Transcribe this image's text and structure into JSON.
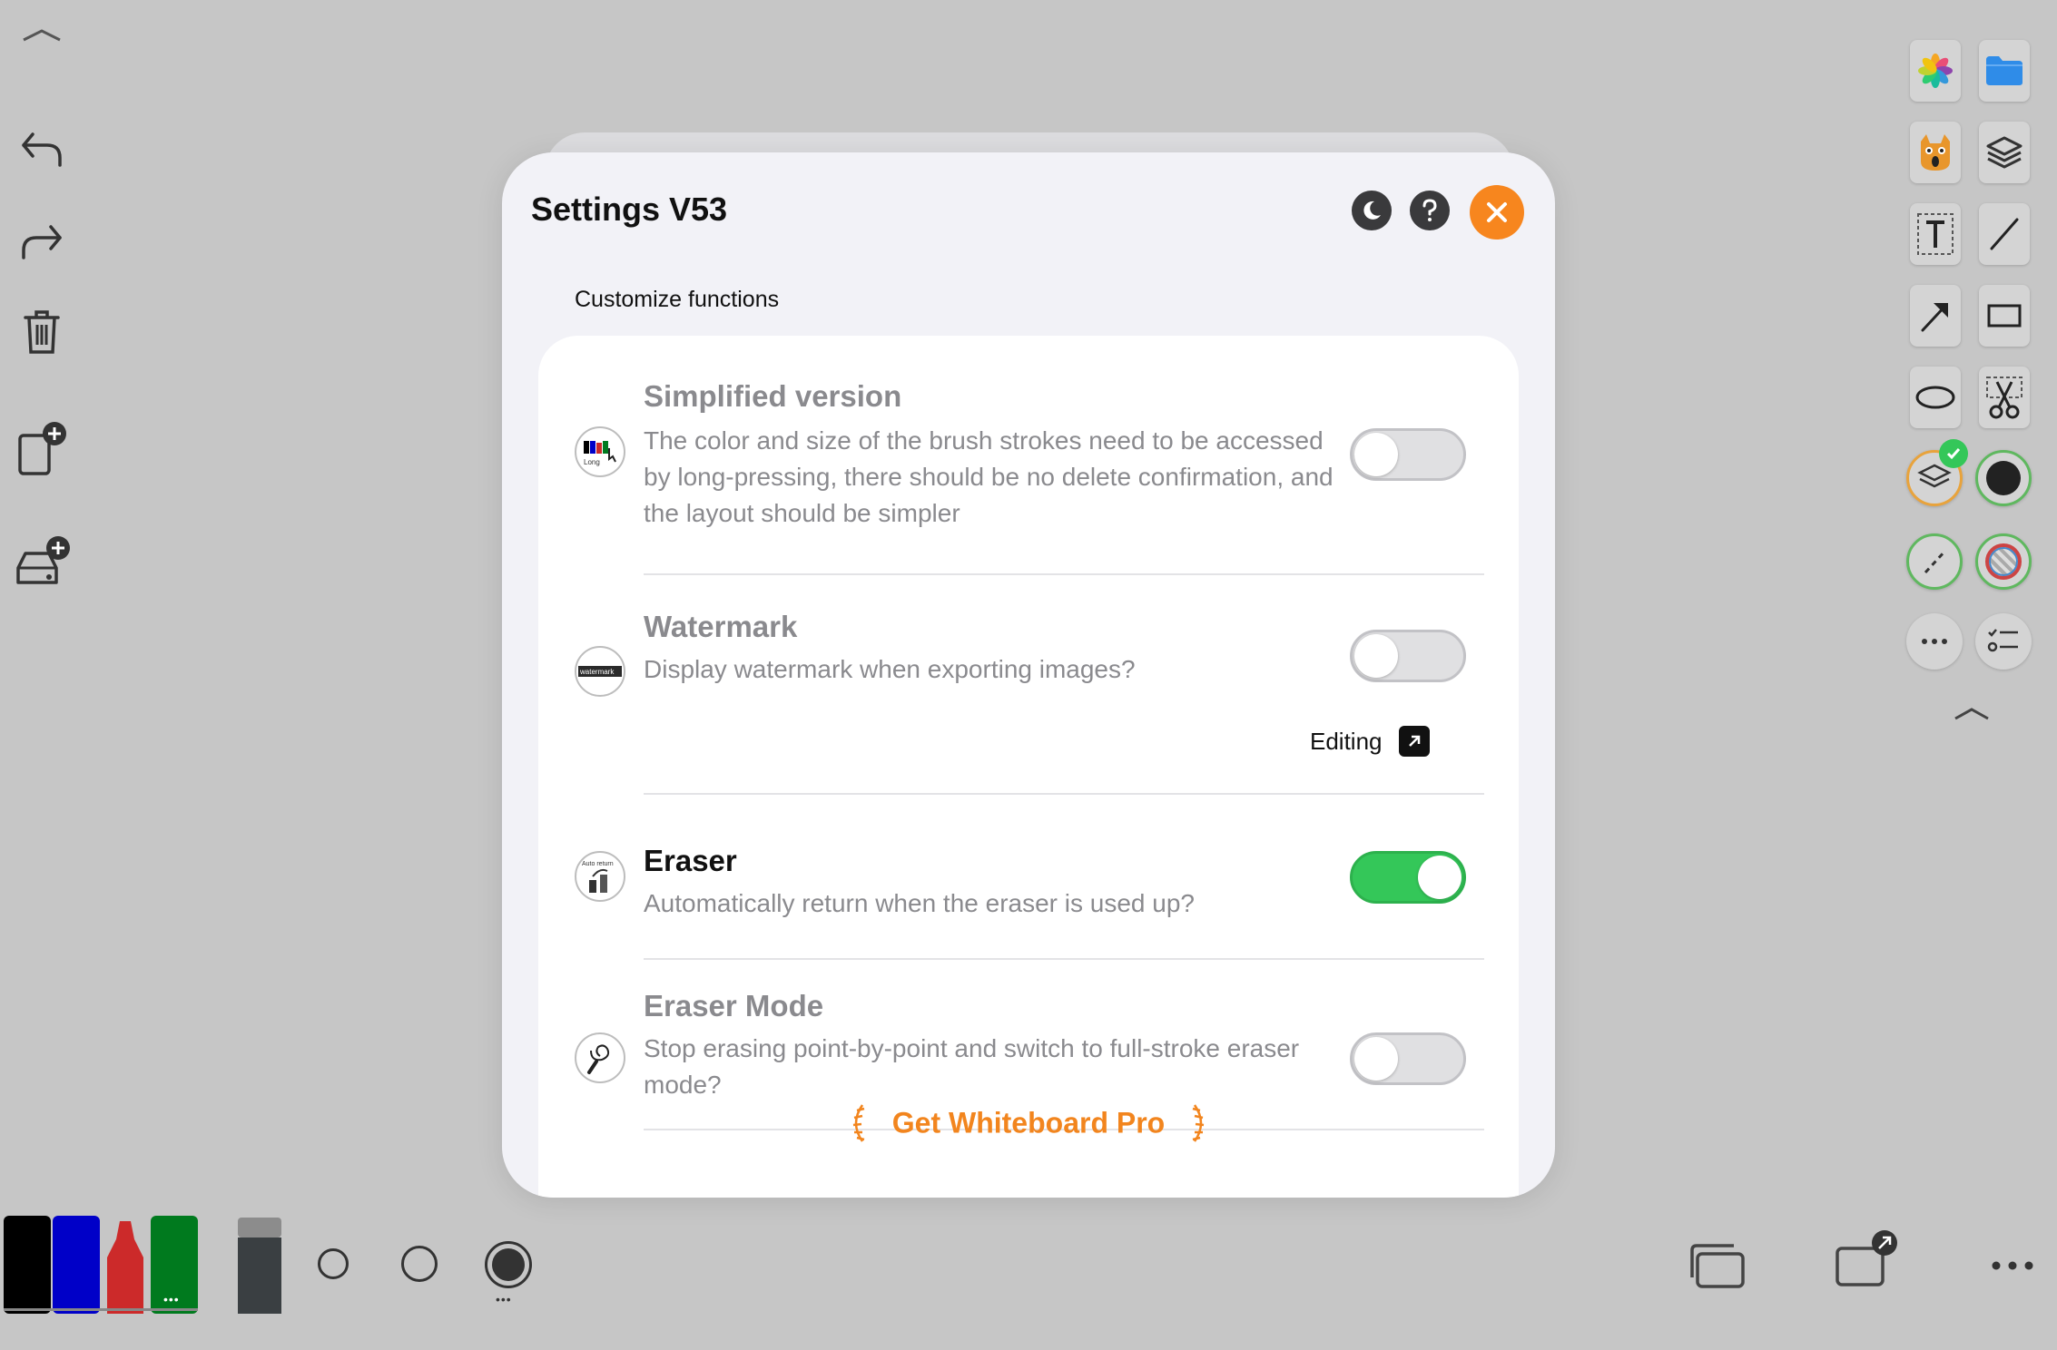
{
  "app": {
    "collapse_top": "︿",
    "collapse_right": "︿"
  },
  "left_toolbar": {
    "items": [
      {
        "name": "undo-icon"
      },
      {
        "name": "redo-icon"
      },
      {
        "name": "trash-icon"
      },
      {
        "name": "new-page-icon"
      },
      {
        "name": "storage-add-icon"
      }
    ]
  },
  "settings": {
    "title": "Settings V53",
    "section_label": "Customize functions",
    "rows": [
      {
        "title": "Simplified version",
        "description": "The color and size of the brush strokes need to be accessed by long-pressing, there should be no delete confirmation, and the layout should be simpler",
        "icon_caption": "Long",
        "enabled": false
      },
      {
        "title": "Watermark",
        "description": "Display watermark when exporting images?",
        "icon_caption": "watermark",
        "enabled": false,
        "link_label": "Editing"
      },
      {
        "title": "Eraser",
        "description": "Automatically return when the eraser is used up?",
        "icon_caption": "Auto return",
        "enabled": true
      },
      {
        "title": "Eraser Mode",
        "description": "Stop erasing point-by-point and switch to full-stroke eraser mode?",
        "enabled": false
      }
    ],
    "pro_banner": "Get Whiteboard Pro"
  },
  "bottom_bar": {
    "markers": [
      "#000000",
      "#0000c8",
      "#cc2a2a",
      "#007a1e"
    ],
    "more_dots": "•••"
  },
  "colors": {
    "accent_orange": "#f7861e",
    "toggle_on": "#34c759",
    "background": "#c6c6c6"
  }
}
